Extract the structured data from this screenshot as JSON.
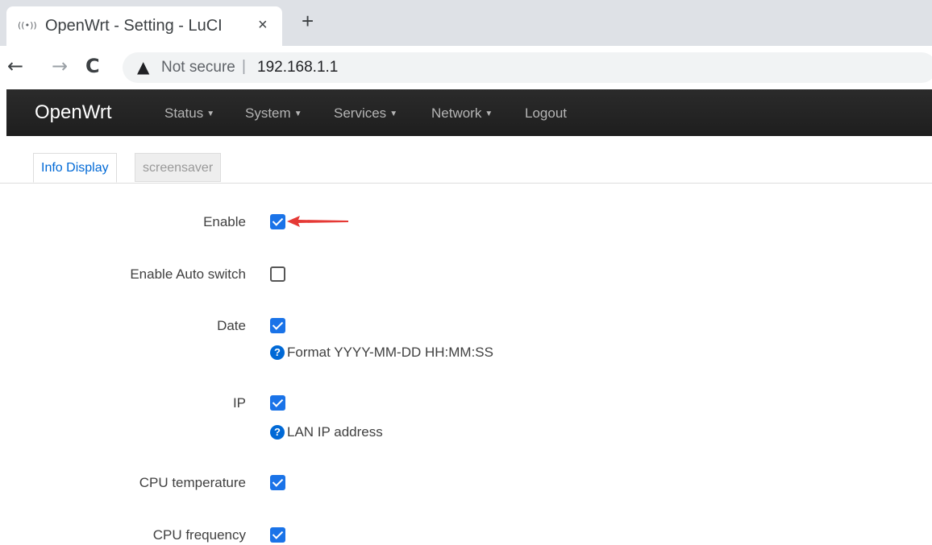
{
  "browser": {
    "tab_title": "OpenWrt - Setting - LuCI",
    "tab_favicon": "((•))",
    "tab_close": "×",
    "new_tab": "+",
    "back": "←",
    "forward": "→",
    "reload": "C",
    "security_icon": "▲",
    "security_label": "Not secure",
    "separator": "|",
    "url": "192.168.1.1"
  },
  "header": {
    "brand": "OpenWrt",
    "menu": [
      {
        "label": "Status",
        "caret": "▼"
      },
      {
        "label": "System",
        "caret": "▼"
      },
      {
        "label": "Services",
        "caret": "▼"
      },
      {
        "label": "Network",
        "caret": "▼"
      },
      {
        "label": "Logout"
      }
    ]
  },
  "tabs": [
    {
      "label": "Info Display",
      "active": true
    },
    {
      "label": "screensaver",
      "active": false
    }
  ],
  "form": {
    "rows": [
      {
        "label": "Enable",
        "checked": true
      },
      {
        "label": "Enable Auto switch",
        "checked": false
      },
      {
        "label": "Date",
        "checked": true,
        "help": "Format YYYY-MM-DD HH:MM:SS"
      },
      {
        "label": "IP",
        "checked": true,
        "help": "LAN IP address"
      },
      {
        "label": "CPU temperature",
        "checked": true
      },
      {
        "label": "CPU frequency",
        "checked": true
      }
    ],
    "help_icon": "?"
  },
  "colors": {
    "accent": "#0069d6",
    "checkbox": "#1a73e8",
    "annotation_arrow": "#e53935",
    "header_bg": "#222222"
  }
}
